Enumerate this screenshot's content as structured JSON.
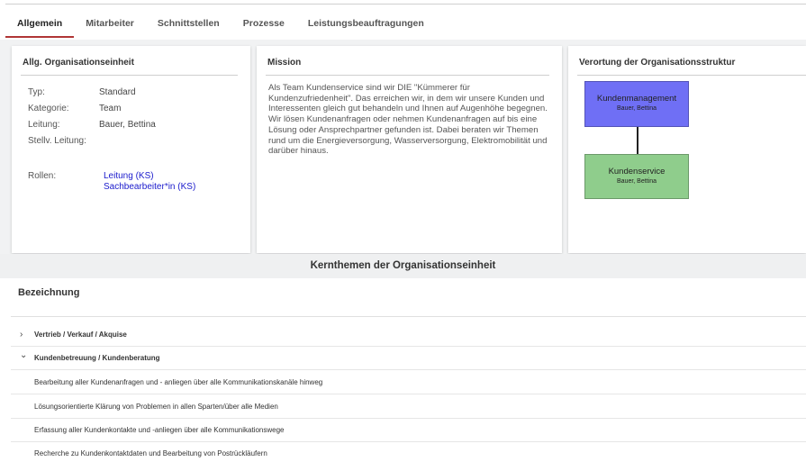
{
  "tabs": [
    {
      "label": "Allgemein",
      "active": true
    },
    {
      "label": "Mitarbeiter",
      "active": false
    },
    {
      "label": "Schnittstellen",
      "active": false
    },
    {
      "label": "Prozesse",
      "active": false
    },
    {
      "label": "Leistungsbeauftragungen",
      "active": false
    }
  ],
  "org_unit": {
    "title": "Allg. Organisationseinheit",
    "type_label": "Typ:",
    "type_value": "Standard",
    "category_label": "Kategorie:",
    "category_value": "Team",
    "lead_label": "Leitung:",
    "lead_value": "Bauer, Bettina",
    "deputy_label": "Stellv. Leitung:",
    "deputy_value": "",
    "roles_label": "Rollen:",
    "roles": [
      "Leitung (KS)",
      "Sachbearbeiter*in (KS)"
    ]
  },
  "mission": {
    "title": "Mission",
    "text": "Als Team Kundenservice sind wir DIE \"Kümmerer für Kundenzufriedenheit\". Das erreichen wir, in dem wir unsere Kunden und Interessenten gleich gut behandeln und Ihnen auf Augenhöhe begegnen. Wir lösen Kundenanfragen oder nehmen Kundenanfragen auf bis eine Lösung oder Ansprechpartner gefunden ist. Dabei beraten wir Themen rund um die Energieversorgung, Wasserversorgung, Elektromobilität und darüber hinaus."
  },
  "structure": {
    "title": "Verortung der Organisationsstruktur",
    "parent": {
      "name": "Kundenmanagement",
      "person": "Bauer, Bettina",
      "color": "#6f6ff5"
    },
    "child": {
      "name": "Kundenservice",
      "person": "Bauer, Bettina",
      "color": "#8fcd8c"
    }
  },
  "core_topics": {
    "title": "Kernthemen der Organisationseinheit",
    "column_header": "Bezeichnung",
    "groups": [
      {
        "label": "Vertrieb / Verkauf / Akquise",
        "expanded": false,
        "chevron": "›"
      },
      {
        "label": "Kundenbetreuung / Kundenberatung",
        "expanded": true,
        "chevron": "⌄"
      }
    ],
    "items": [
      "Bearbeitung aller Kundenanfragen und - anliegen über alle Kommunikationskanäle hinweg",
      "Lösungsorientierte Klärung von Problemen in allen Sparten/über alle Medien",
      "Erfassung aller Kundenkontakte und -anliegen über alle Kommunikationswege",
      "Recherche zu Kundenkontaktdaten und Bearbeitung von Postrückläufern"
    ]
  },
  "colors": {
    "tab_accent": "#b03535",
    "link": "#1a1acc"
  }
}
